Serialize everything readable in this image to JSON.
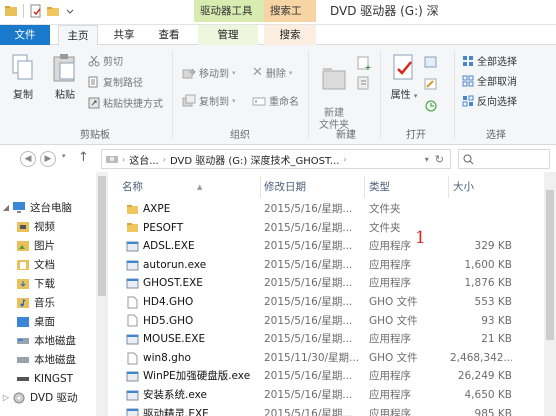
{
  "titlebar": {
    "contextual_tabs": [
      "驱动器工具",
      "搜索工具"
    ],
    "title": "DVD 驱动器 (G:) 深"
  },
  "tabs": [
    "文件",
    "主页",
    "共享",
    "查看",
    "管理",
    "搜索"
  ],
  "ribbon": {
    "clipboard": {
      "copy": "复制",
      "paste": "粘贴",
      "cut": "剪切",
      "copy_path": "复制路径",
      "paste_shortcut": "粘贴快捷方式",
      "label": "剪贴板"
    },
    "organize": {
      "move_to": "移动到",
      "copy_to": "复制到",
      "delete": "删除",
      "rename": "重命名",
      "label": "组织"
    },
    "new": {
      "new_folder": "新建\n文件夹",
      "label": "新建"
    },
    "open": {
      "properties": "属性",
      "label": "打开"
    },
    "select": {
      "select_all": "全部选择",
      "select_none": "全部取消",
      "invert": "反向选择",
      "label": "选择"
    }
  },
  "address": {
    "crumbs": [
      "这台...",
      "DVD 驱动器 (G:) 深度技术_GHOST..."
    ]
  },
  "nav": {
    "items": [
      {
        "label": "这台电脑",
        "icon": "computer-icon"
      },
      {
        "label": "视频",
        "icon": "video-folder-icon"
      },
      {
        "label": "图片",
        "icon": "picture-folder-icon"
      },
      {
        "label": "文档",
        "icon": "document-folder-icon"
      },
      {
        "label": "下载",
        "icon": "download-folder-icon"
      },
      {
        "label": "音乐",
        "icon": "music-folder-icon"
      },
      {
        "label": "桌面",
        "icon": "desktop-folder-icon"
      },
      {
        "label": "本地磁盘",
        "icon": "disk-icon"
      },
      {
        "label": "本地磁盘",
        "icon": "disk-icon"
      },
      {
        "label": "KINGST",
        "icon": "usb-drive-icon"
      },
      {
        "label": "DVD 驱动",
        "icon": "dvd-drive-icon"
      }
    ]
  },
  "columns": {
    "name": "名称",
    "date": "修改日期",
    "type": "类型",
    "size": "大小"
  },
  "files": [
    {
      "name": "AXPE",
      "date": "2015/5/16/星期...",
      "type": "文件夹",
      "size": "",
      "icon": "folder"
    },
    {
      "name": "PESOFT",
      "date": "2015/5/16/星期...",
      "type": "文件夹",
      "size": "",
      "icon": "folder"
    },
    {
      "name": "ADSL.EXE",
      "date": "2015/5/16/星期...",
      "type": "应用程序",
      "size": "329 KB",
      "icon": "exe"
    },
    {
      "name": "autorun.exe",
      "date": "2015/5/16/星期...",
      "type": "应用程序",
      "size": "1,600 KB",
      "icon": "exe"
    },
    {
      "name": "GHOST.EXE",
      "date": "2015/5/16/星期...",
      "type": "应用程序",
      "size": "1,876 KB",
      "icon": "exe"
    },
    {
      "name": "HD4.GHO",
      "date": "2015/5/16/星期...",
      "type": "GHO 文件",
      "size": "553 KB",
      "icon": "file"
    },
    {
      "name": "HD5.GHO",
      "date": "2015/5/16/星期...",
      "type": "GHO 文件",
      "size": "93 KB",
      "icon": "file"
    },
    {
      "name": "MOUSE.EXE",
      "date": "2015/5/16/星期...",
      "type": "应用程序",
      "size": "21 KB",
      "icon": "exe"
    },
    {
      "name": "win8.gho",
      "date": "2015/11/30/星期...",
      "type": "GHO 文件",
      "size": "2,468,342...",
      "icon": "file"
    },
    {
      "name": "WinPE加强硬盘版.exe",
      "date": "2015/5/16/星期...",
      "type": "应用程序",
      "size": "26,249 KB",
      "icon": "exe"
    },
    {
      "name": "安装系统.exe",
      "date": "2015/5/16/星期...",
      "type": "应用程序",
      "size": "4,650 KB",
      "icon": "exe"
    },
    {
      "name": "驱动精灵.EXE",
      "date": "2015/5/16/星期...",
      "type": "应用程序",
      "size": "985 KB",
      "icon": "exe"
    }
  ],
  "annotation": "1",
  "colors": {
    "file_tab": "#1979ca",
    "drive_tools": "#d8ecb2",
    "search_tools": "#f7d4a4",
    "annotation": "#d9261c"
  }
}
